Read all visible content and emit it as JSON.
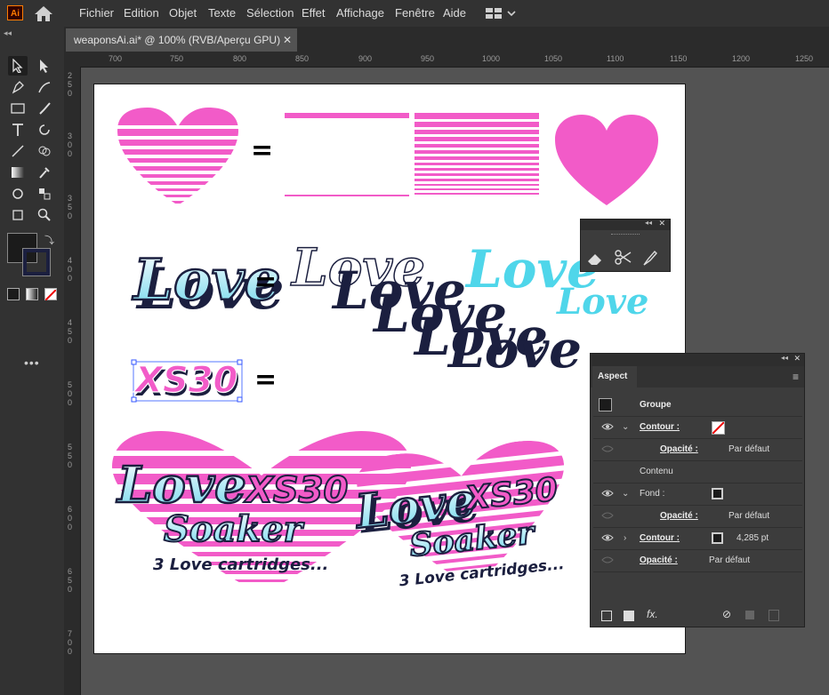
{
  "app": {
    "logo_text": "Ai"
  },
  "menu": [
    "Fichier",
    "Edition",
    "Objet",
    "Texte",
    "Sélection",
    "Effet",
    "Affichage",
    "Fenêtre",
    "Aide"
  ],
  "document": {
    "tab_title": "weaponsAi.ai* @ 100% (RVB/Aperçu GPU)",
    "close_label": "✕"
  },
  "ruler": {
    "top_ticks": [
      "700",
      "750",
      "800",
      "850",
      "900",
      "950",
      "1000",
      "1050",
      "1100",
      "1150",
      "1200",
      "1250"
    ],
    "left_ticks": [
      "2 5 0",
      "3 0 0",
      "3 5 0",
      "4 0 0",
      "4 5 0",
      "5 0 0",
      "5 5 0",
      "6 0 0",
      "6 5 0",
      "7 0 0"
    ]
  },
  "artwork": {
    "equals": "=",
    "love": "Love",
    "xs30": "XS30",
    "soaker": "Soaker",
    "tagline": "3 Love cartridges...",
    "colors": {
      "pink": "#f25bc8",
      "navy": "#1b1f3f",
      "cyan": "#4fd6ea"
    }
  },
  "aspect_panel": {
    "tab": "Aspect",
    "groupe": "Groupe",
    "contour_label": "Contour :",
    "opacite_label": "Opacité :",
    "par_defaut": "Par défaut",
    "contenu": "Contenu",
    "fond_label": "Fond :",
    "stroke_weight": "4,285 pt",
    "fx": "fx."
  }
}
